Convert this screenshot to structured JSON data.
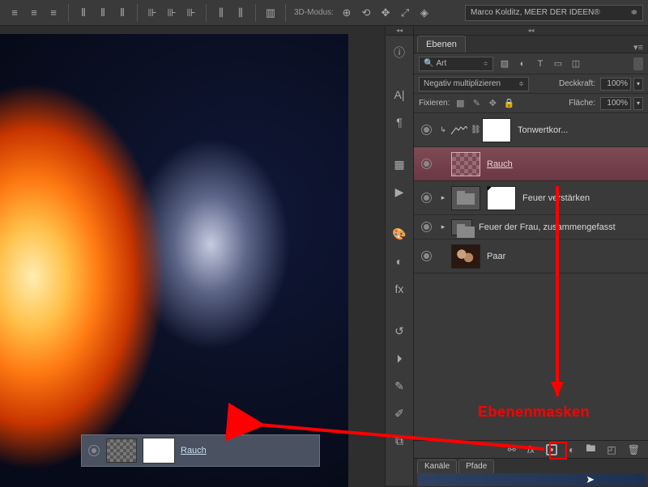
{
  "optbar": {
    "mode3d_label": "3D-Modus:",
    "workspace": "Marco Kolditz, MEER DER IDEEN®"
  },
  "layers_panel": {
    "tab": "Ebenen",
    "search_kind": "Art",
    "blend_mode": "Negativ multiplizieren",
    "opacity_label": "Deckkraft:",
    "opacity_value": "100%",
    "lock_label": "Fixieren:",
    "fill_label": "Fläche:",
    "fill_value": "100%",
    "layers": [
      {
        "name": "Tonwertkor..."
      },
      {
        "name": "Rauch"
      },
      {
        "name": "Feuer verstärken"
      },
      {
        "name": "Feuer der Frau, zusammengefasst"
      },
      {
        "name": "Paar"
      }
    ],
    "bottom_icons": [
      "link",
      "fx",
      "mask",
      "adjust",
      "group",
      "new",
      "trash"
    ]
  },
  "channels_panel": {
    "tabs": [
      "Kanäle",
      "Pfade"
    ]
  },
  "tooltip": {
    "label": "Rauch"
  },
  "annotation": {
    "label": "Ebenenmasken"
  }
}
